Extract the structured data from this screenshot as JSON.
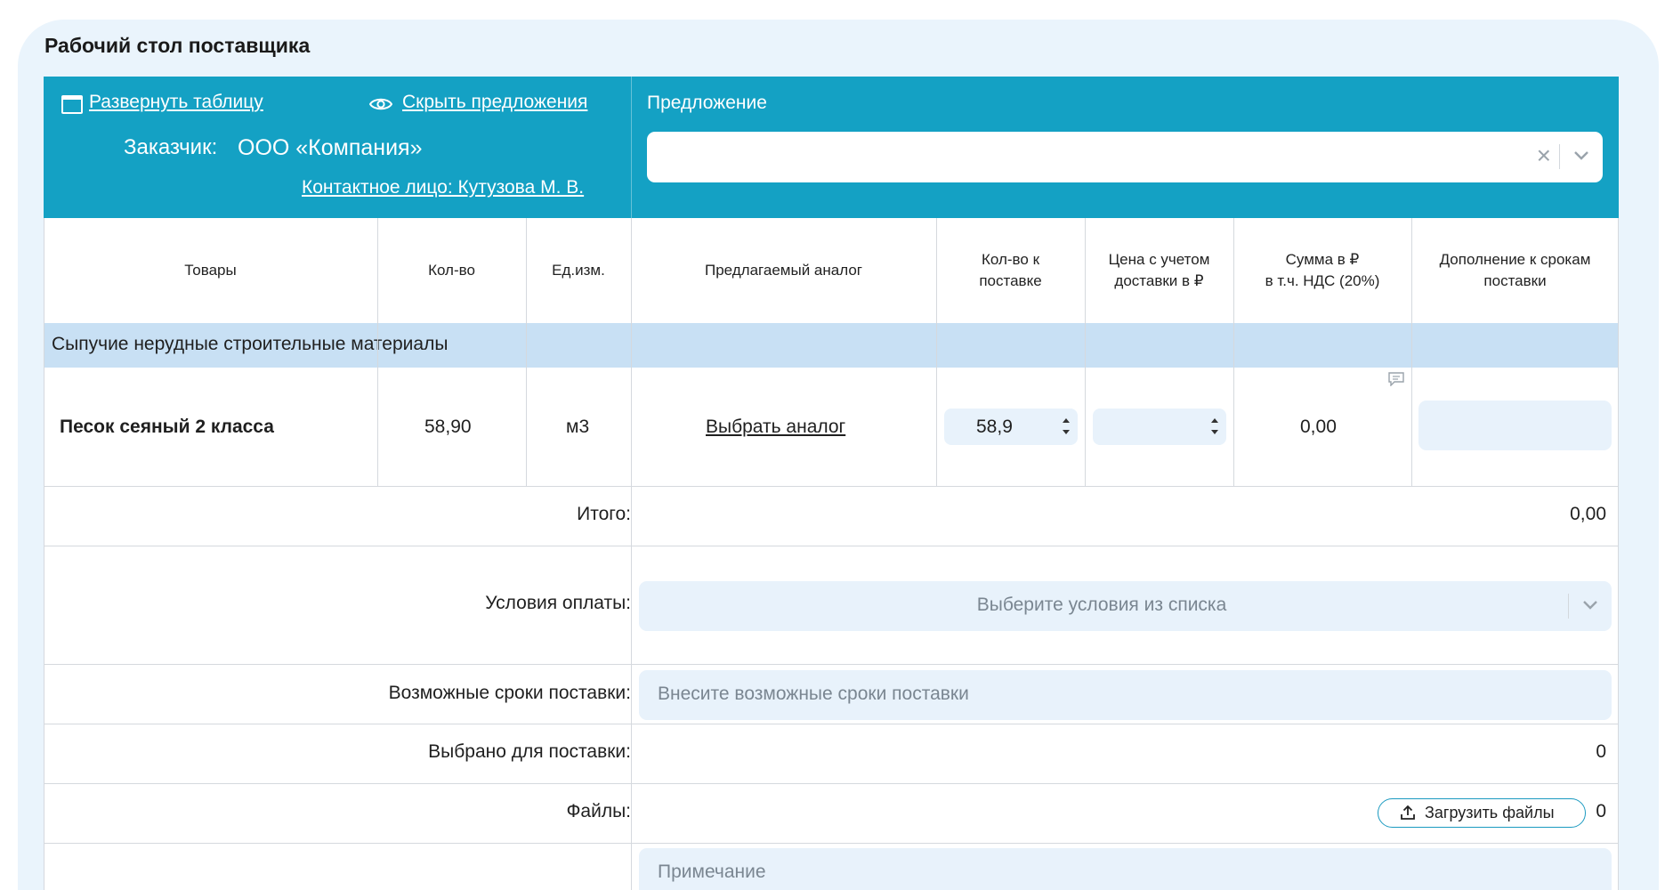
{
  "page": {
    "title": "Рабочий стол поставщика"
  },
  "header": {
    "expand_link": "Развернуть таблицу",
    "hide_offers_link": "Скрыть предложения",
    "customer_label": "Заказчик:",
    "customer_name": "ООО «Компания»",
    "contact_link": "Контактное лицо: Кутузова М. В.",
    "offer_label": "Предложение",
    "offer_value": ""
  },
  "columns": {
    "goods": "Товары",
    "qty": "Кол-во",
    "unit": "Ед.изм.",
    "analog": "Предлагаемый аналог",
    "qty_delivery_1": "Кол-во к",
    "qty_delivery_2": "поставке",
    "price_1": "Цена с учетом",
    "price_2": "доставки в ₽",
    "sum_1": "Сумма в ₽",
    "sum_2": "в т.ч. НДС (20%)",
    "terms_1": "Дополнение к срокам",
    "terms_2": "поставки"
  },
  "group": {
    "name": "Сыпучие нерудные строительные материалы"
  },
  "item": {
    "name": "Песок сеяный 2 класса",
    "qty": "58,90",
    "unit": "м3",
    "analog_link": "Выбрать аналог",
    "qty_delivery": "58,9",
    "price": "",
    "sum": "0,00"
  },
  "totals": {
    "total_label": "Итого:",
    "total_value": "0,00",
    "payment_label": "Условия оплаты:",
    "payment_placeholder": "Выберите условия из списка",
    "delivery_terms_label": "Возможные сроки поставки:",
    "delivery_terms_placeholder": "Внесите возможные сроки поставки",
    "selected_label": "Выбрано для поставки:",
    "selected_value": "0",
    "files_label": "Файлы:",
    "upload_button": "Загрузить файлы",
    "files_count": "0",
    "note_placeholder": "Примечание"
  },
  "icons": [
    "expand-table-icon",
    "eye-icon",
    "clear-icon",
    "chevron-down-icon",
    "spinner-arrows-icon",
    "comment-icon",
    "upload-icon"
  ],
  "colors": {
    "header_bg": "#14a1c4",
    "group_bg": "#c8e0f4",
    "panel_bg": "#eaf4fc",
    "field_bg": "#e8f2fb"
  }
}
